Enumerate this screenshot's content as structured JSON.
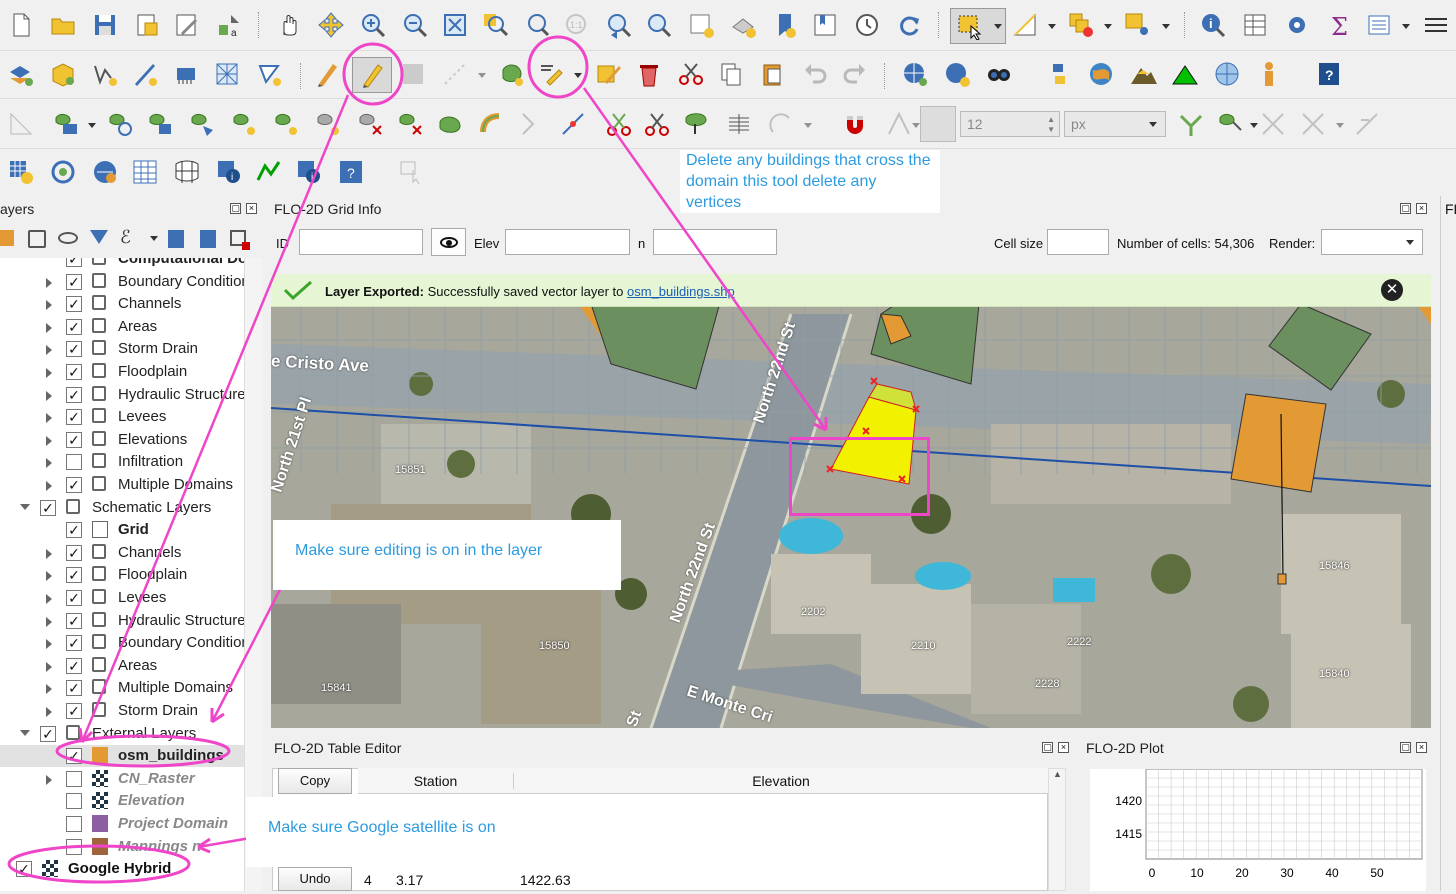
{
  "panels": {
    "layers_title": "ayers",
    "grid_info_title": "FLO-2D Grid Info",
    "table_editor_title": "FLO-2D Table Editor",
    "plot_title": "FLO-2D Plot",
    "right_edge_title": "FL"
  },
  "grid_info": {
    "id_label": "ID",
    "elev_label": "Elev",
    "n_label": "n",
    "cell_size_label": "Cell size",
    "num_cells": "Number of cells: 54,306",
    "render_label": "Render:"
  },
  "message_bar": {
    "bold": "Layer Exported:",
    "text": " Successfully saved vector layer to ",
    "link": "osm_buildings.shp"
  },
  "snapping": {
    "tolerance": "12",
    "units": "px"
  },
  "layers": [
    {
      "label": "Computational Do",
      "checked": true,
      "bold": true,
      "indent": 1
    },
    {
      "label": "Boundary Condition",
      "checked": true,
      "indent": 1
    },
    {
      "label": "Channels",
      "checked": true,
      "indent": 1
    },
    {
      "label": "Areas",
      "checked": true,
      "indent": 1
    },
    {
      "label": "Storm Drain",
      "checked": true,
      "indent": 1
    },
    {
      "label": "Floodplain",
      "checked": true,
      "indent": 1
    },
    {
      "label": "Hydraulic Structure",
      "checked": true,
      "indent": 1
    },
    {
      "label": "Levees",
      "checked": true,
      "indent": 1
    },
    {
      "label": "Elevations",
      "checked": true,
      "indent": 1
    },
    {
      "label": "Infiltration",
      "checked": false,
      "indent": 1
    },
    {
      "label": "Multiple Domains",
      "checked": true,
      "indent": 1
    },
    {
      "label": "Schematic Layers",
      "checked": true,
      "indent": 0
    },
    {
      "label": "Grid",
      "checked": true,
      "bold": true,
      "indent": 1
    },
    {
      "label": "Channels",
      "checked": true,
      "indent": 1
    },
    {
      "label": "Floodplain",
      "checked": true,
      "indent": 1
    },
    {
      "label": "Levees",
      "checked": true,
      "indent": 1
    },
    {
      "label": "Hydraulic Structure",
      "checked": true,
      "indent": 1
    },
    {
      "label": "Boundary Condition",
      "checked": true,
      "indent": 1
    },
    {
      "label": "Areas",
      "checked": true,
      "indent": 1
    },
    {
      "label": "Multiple Domains",
      "checked": true,
      "indent": 1
    },
    {
      "label": "Storm Drain",
      "checked": true,
      "indent": 1
    },
    {
      "label": "External Layers",
      "checked": true,
      "indent": 0
    },
    {
      "label": "osm_buildings",
      "checked": true,
      "bold": true,
      "indent": 1
    },
    {
      "label": "CN_Raster",
      "checked": false,
      "italic": true,
      "indent": 1
    },
    {
      "label": "Elevation",
      "checked": false,
      "italic": true,
      "indent": 1
    },
    {
      "label": "Project Domain",
      "checked": false,
      "italic": true,
      "indent": 1
    },
    {
      "label": "Mannings n",
      "checked": false,
      "italic": true,
      "indent": 1
    },
    {
      "label": "Google Hybrid",
      "checked": true,
      "bold": true,
      "indent": 0
    }
  ],
  "map_labels": {
    "street1": "e Cristo Ave",
    "street2": "North 21st Pl",
    "street3": "North 22nd St",
    "street4": "North 22nd St",
    "street5": "E Monte Cri",
    "street6": "St",
    "addr1": "15851",
    "addr2": "15850",
    "addr3": "15841",
    "addr4": "2202",
    "addr5": "2210",
    "addr6": "2222",
    "addr7": "2228",
    "addr8": "15846",
    "addr9": "15840"
  },
  "table_editor": {
    "copy_button": "Copy",
    "undo_button": "Undo",
    "col_station": "Station",
    "col_elevation": "Elevation",
    "row_index": "4",
    "row_station": "3.17",
    "row_elevation": "1422.63"
  },
  "plot": {
    "y_ticks": [
      "1420",
      "1415"
    ],
    "x_ticks": [
      "0",
      "10",
      "20",
      "30",
      "40",
      "50"
    ]
  },
  "annotations": {
    "delete_note": "Delete any buildings that cross the domain this tool delete any vertices",
    "editing_note": "Make sure editing is on in the layer",
    "google_note": "Make sure Google satellite is on"
  },
  "colors": {
    "annotation_pink": "#ef45c8",
    "annotation_blue": "#2d9bdf",
    "message_green": "#e6f5d4",
    "building_green": "#6b8f5e",
    "building_orange": "#e39a34",
    "selected_yellow": "#f2f200"
  }
}
